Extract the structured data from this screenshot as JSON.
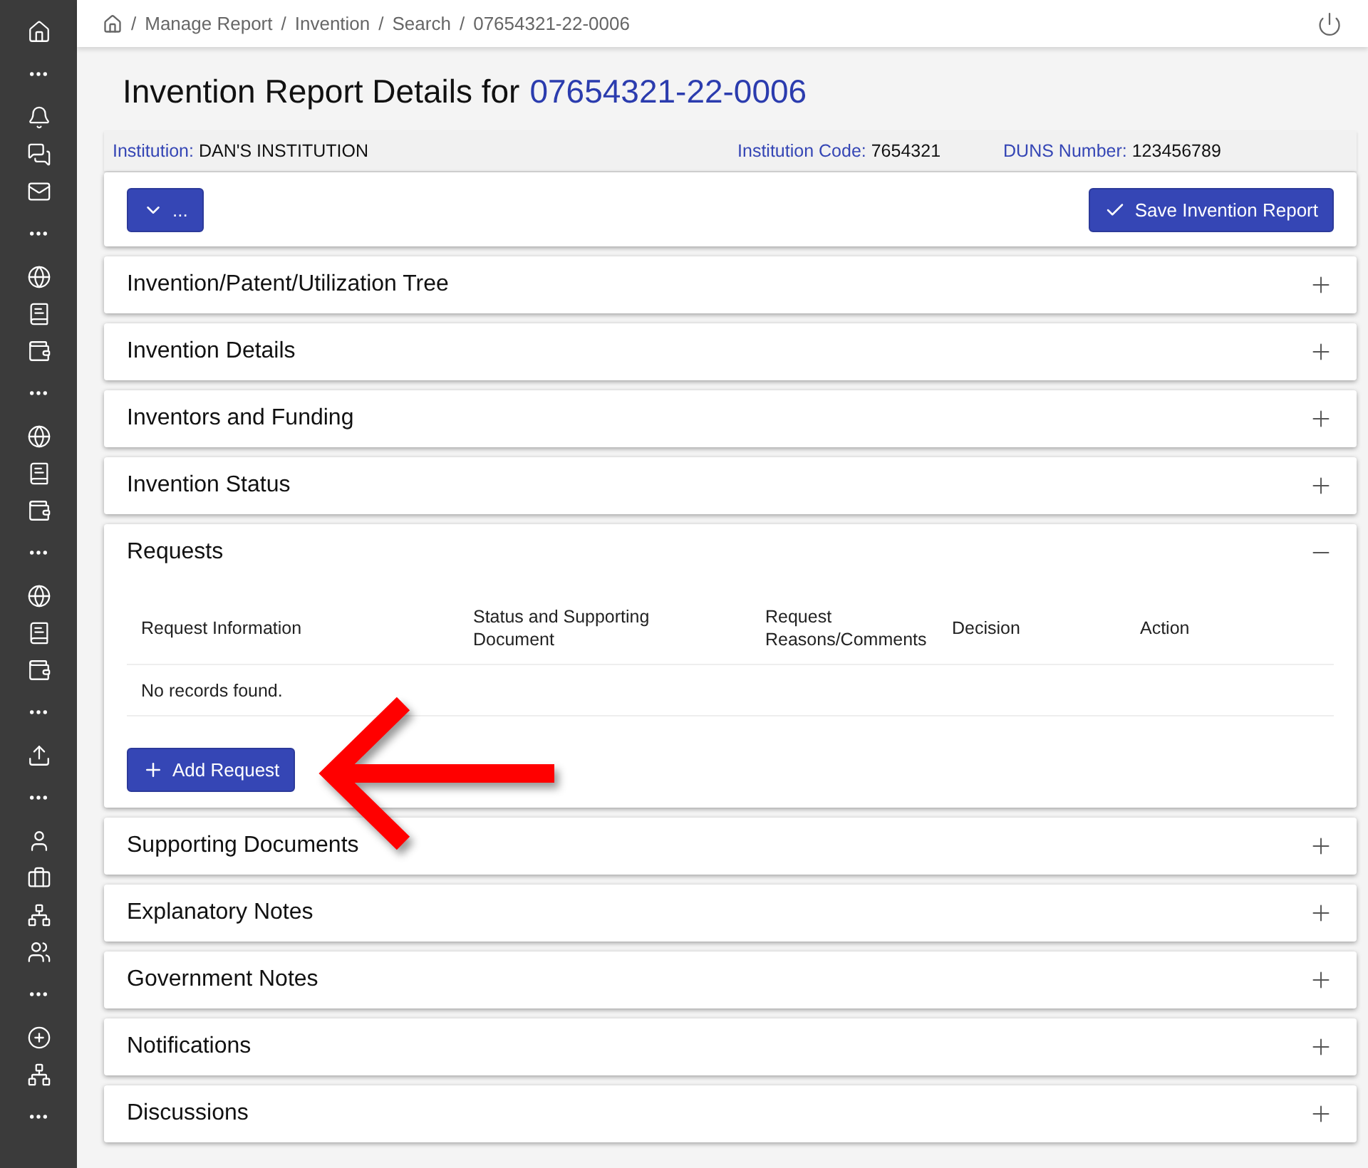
{
  "breadcrumb_separator": "/",
  "breadcrumb": [
    "Manage Report",
    "Invention",
    "Search",
    "07654321-22-0006"
  ],
  "title": {
    "text": "Invention Report Details for",
    "id_link": "07654321-22-0006"
  },
  "info": [
    {
      "label": "Institution:",
      "value": "DAN'S INSTITUTION"
    },
    {
      "label": "Institution Code:",
      "value": "7654321"
    },
    {
      "label": "DUNS Number:",
      "value": "123456789"
    }
  ],
  "toolbar": {
    "menu_button": "...",
    "save_button": "Save Invention Report"
  },
  "sections": [
    {
      "title": "Invention/Patent/Utilization Tree",
      "expanded": false
    },
    {
      "title": "Invention Details",
      "expanded": false
    },
    {
      "title": "Inventors and Funding",
      "expanded": false
    },
    {
      "title": "Invention Status",
      "expanded": false
    },
    {
      "title": "Requests",
      "expanded": true,
      "table": {
        "columns": [
          "Request Information",
          "Status and Supporting Document",
          "Request Reasons/Comments",
          "Decision",
          "Action"
        ],
        "empty_message": "No records found."
      },
      "add_button": "Add Request"
    },
    {
      "title": "Supporting Documents",
      "expanded": false
    },
    {
      "title": "Explanatory Notes",
      "expanded": false
    },
    {
      "title": "Government Notes",
      "expanded": false
    },
    {
      "title": "Notifications",
      "expanded": false
    },
    {
      "title": "Discussions",
      "expanded": false
    }
  ]
}
